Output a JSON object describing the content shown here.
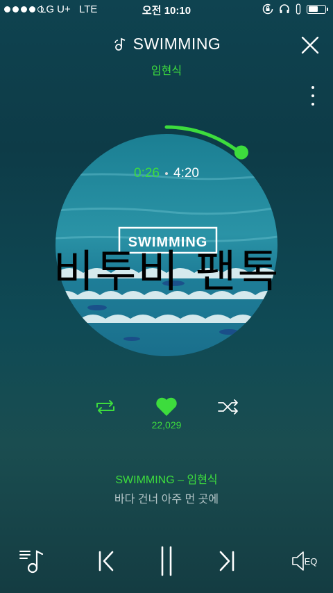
{
  "status_bar": {
    "carrier": "LG U+",
    "network": "LTE",
    "time": "오전 10:10",
    "signal_bars_filled": 4,
    "signal_bars_total": 5,
    "icons": [
      "rotation-lock-icon",
      "headphones-icon",
      "battery-icon"
    ]
  },
  "header": {
    "title": "SWIMMING",
    "title_icon": "music-note-icon",
    "artist": "임현식",
    "close_icon": "close-icon",
    "more_icon": "more-vertical-icon"
  },
  "player": {
    "elapsed": "0:26",
    "total": "4:20",
    "progress_fraction": 0.1,
    "album_text": "SWIMMING",
    "overlay_text": "비투비 팬톡"
  },
  "actions": {
    "repeat_icon": "repeat-icon",
    "like_icon": "heart-icon",
    "like_count": "22,029",
    "shuffle_icon": "shuffle-icon"
  },
  "lyrics": {
    "title_line": "SWIMMING – 임현식",
    "current_line": "바다 건너 아주 먼 곳에"
  },
  "controls": {
    "playlist_icon": "playlist-icon",
    "prev_icon": "previous-icon",
    "pause_icon": "pause-icon",
    "next_icon": "next-icon",
    "eq_label": "EQ"
  },
  "colors": {
    "accent": "#3ddc3d",
    "background": "#0f4350"
  }
}
